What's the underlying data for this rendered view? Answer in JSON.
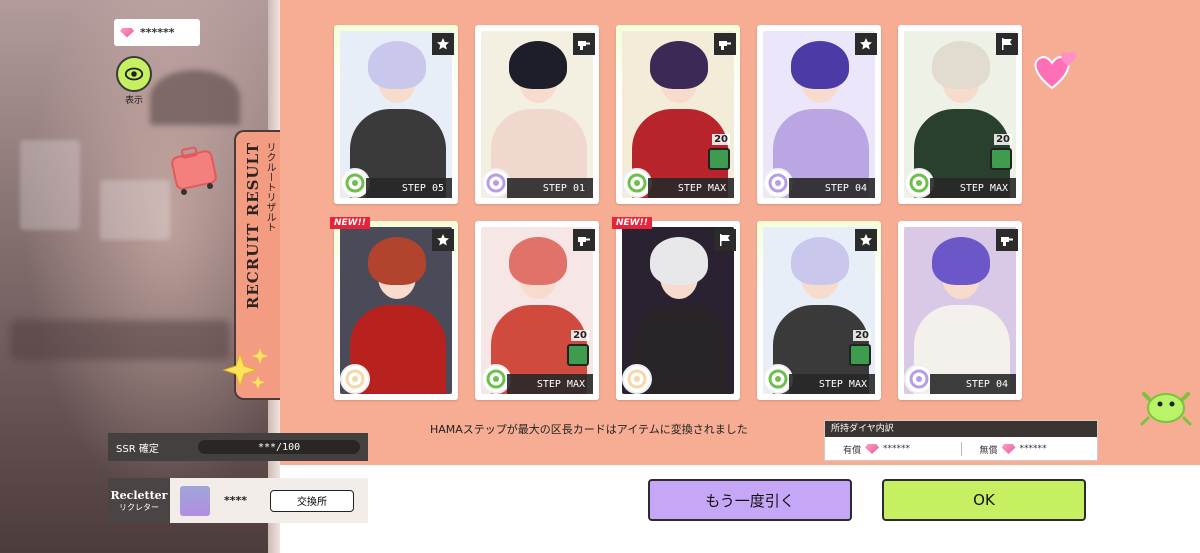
{
  "currency": {
    "value": "******",
    "icon": "diamond-icon"
  },
  "eye": {
    "label": "表示"
  },
  "tab": {
    "title": "RECRUIT RESULT",
    "subtitle": "リクルートリザルト"
  },
  "cards": [
    {
      "step": "STEP 05",
      "type": "star-icon",
      "attr": "green",
      "new": false,
      "count": null,
      "hair": "#c9c7ec",
      "bg": "#e8eef7",
      "body": "#3a3a3a"
    },
    {
      "step": "STEP 01",
      "type": "drill-icon",
      "attr": "purple",
      "new": false,
      "count": null,
      "hair": "#1e1e2a",
      "bg": "#f3f0e2",
      "body": "#f0d8cf"
    },
    {
      "step": "STEP MAX",
      "type": "drill-icon",
      "attr": "green",
      "new": false,
      "count": "20",
      "hair": "#3a2a55",
      "bg": "#f2ecd8",
      "body": "#b8242c"
    },
    {
      "step": "STEP 04",
      "type": "star-icon",
      "attr": "purple",
      "new": false,
      "count": null,
      "hair": "#4c3aa6",
      "bg": "#ece6fb",
      "body": "#b9a6e2"
    },
    {
      "step": "STEP MAX",
      "type": "flag-icon",
      "attr": "green",
      "new": false,
      "count": "20",
      "hair": "#e1dccf",
      "bg": "#eef1e6",
      "body": "#29402c"
    },
    {
      "step": "",
      "type": "star-icon",
      "attr": "peach",
      "new": true,
      "count": null,
      "hair": "#b2432d",
      "bg": "#4a4a58",
      "body": "#b8221e"
    },
    {
      "step": "STEP MAX",
      "type": "drill-icon",
      "attr": "green",
      "new": false,
      "count": "20",
      "hair": "#e0726a",
      "bg": "#f6e6e6",
      "body": "#d04a3e"
    },
    {
      "step": "",
      "type": "flag-icon",
      "attr": "peach",
      "new": true,
      "count": null,
      "hair": "#e8e8ea",
      "bg": "#2a2230",
      "body": "#282428"
    },
    {
      "step": "STEP MAX",
      "type": "star-icon",
      "attr": "green",
      "new": false,
      "count": "20",
      "hair": "#c9c7ec",
      "bg": "#e8eef7",
      "body": "#3a3a3a"
    },
    {
      "step": "STEP 04",
      "type": "drill-icon",
      "attr": "purple",
      "new": false,
      "count": null,
      "hair": "#6b57c8",
      "bg": "#d9c9e6",
      "body": "#f4f0ec"
    }
  ],
  "new_label": "NEW!!",
  "notice": "HAMAステップが最大の区長カードはアイテムに変換されました",
  "breakdown": {
    "title": "所持ダイヤ内訳",
    "paid_label": "有償",
    "paid_value": "******",
    "free_label": "無償",
    "free_value": "******"
  },
  "ssr": {
    "label": "SSR 確定",
    "progress": "***/100"
  },
  "recletter": {
    "logo_en": "Recletter",
    "logo_jp": "リクレター",
    "count": "****",
    "exchange_label": "交換所"
  },
  "buttons": {
    "again": "もう一度引く",
    "ok": "OK"
  },
  "colors": {
    "panel": "#f6ad94",
    "ok_button": "#c6f062",
    "again_button": "#c6a7f7",
    "new_tag": "#e8233a"
  }
}
